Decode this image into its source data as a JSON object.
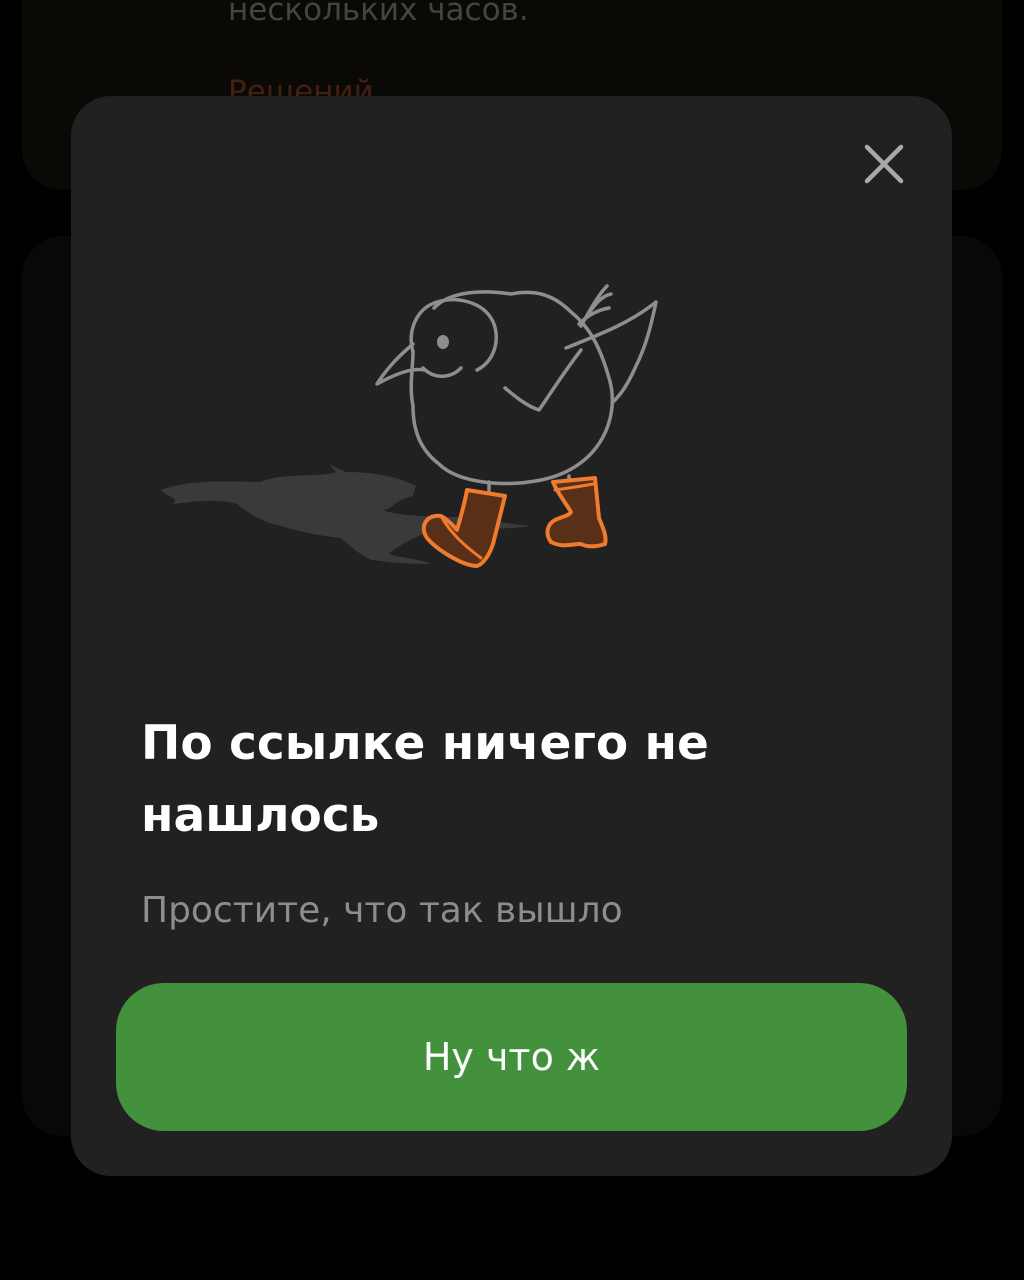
{
  "background": {
    "text": "нескольких часов.",
    "link_partial": "Решений"
  },
  "modal": {
    "close_icon": "close-icon",
    "illustration": "bird-in-boots-illustration",
    "title": "По ссылке ничего не нашлось",
    "subtitle": "Простите, что так вышло",
    "button_label": "Ну что ж"
  },
  "colors": {
    "modal_bg": "#212121",
    "button_bg": "#43903d",
    "title": "#ffffff",
    "subtitle": "#8d8d8d",
    "boots_outline": "#f07a2e",
    "boots_fill": "#5a2f17"
  }
}
